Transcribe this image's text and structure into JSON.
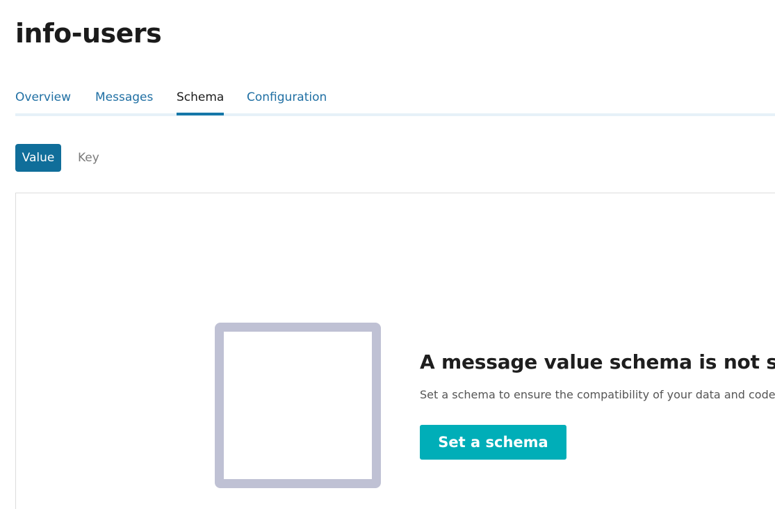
{
  "page": {
    "title": "info-users"
  },
  "tabs": [
    {
      "label": "Overview",
      "active": false
    },
    {
      "label": "Messages",
      "active": false
    },
    {
      "label": "Schema",
      "active": true
    },
    {
      "label": "Configuration",
      "active": false
    }
  ],
  "schema_toggle": {
    "value_label": "Value",
    "key_label": "Key",
    "selected": "Value"
  },
  "empty_state": {
    "title": "A message value schema is not set",
    "description": "Set a schema to ensure the compatibility of your data and code.",
    "button_label": "Set a schema",
    "placeholder_icon": "empty-square-icon"
  },
  "colors": {
    "tab_link": "#1f6fa3",
    "tab_active_underline": "#1577a8",
    "toggle_selected_bg": "#106e9a",
    "cta_bg": "#00aeb8",
    "placeholder_border": "#bfc1d4"
  }
}
